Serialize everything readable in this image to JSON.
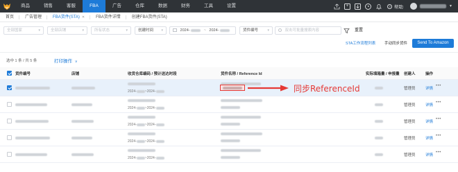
{
  "nav": {
    "items": [
      "商品",
      "销售",
      "客服",
      "FBA",
      "广告",
      "仓库",
      "数据",
      "财务",
      "工具",
      "设置"
    ],
    "active_index": 3,
    "help_label": "帮助",
    "accent_color": "#1e7bd8",
    "icons": [
      "logo-fox-icon",
      "export-icon",
      "plus-box-icon",
      "download-icon",
      "clock-icon",
      "bell-icon",
      "help-icon"
    ]
  },
  "breadcrumb_tabs": {
    "home": "首页",
    "ads": "广告管理",
    "fba_plan": "FBA货件(STA)",
    "fba_detail": "FBA货件详情",
    "create_fba": "创建FBA货件(STA)"
  },
  "filters": {
    "site": "全部国家",
    "shop": "全部店铺",
    "status": "所有状态",
    "time_type": "创建时间",
    "date_start": "2024-",
    "date_end": "2024-",
    "search_field": "货件编号",
    "search_placeholder": "双击可批量搜索内容",
    "reset_label": "重置"
  },
  "actions": {
    "sta_list": "STA工作流程列表",
    "manual_sync": "手动同步货件",
    "send_to_amazon": "Send To Amazon"
  },
  "toolbar": {
    "selection_count": "选中 1 条 / 共 5 条",
    "print_label": "打印操作",
    "print_caret": "∨"
  },
  "table": {
    "columns": [
      "货件编号",
      "店铺",
      "收货仓库编码 / 预计送达时段",
      "货件名称 / Reference Id",
      "实际填箱量 / 申报量",
      "创建人",
      "操作"
    ],
    "rows": [
      {
        "checked": true,
        "date1": "2024-",
        "date2": "2024-",
        "creator": "管理员",
        "action": "详情",
        "more": "•••"
      },
      {
        "checked": false,
        "date1": "2024-",
        "date2": "2024-",
        "creator": "管理员",
        "action": "详情",
        "more": "•••"
      },
      {
        "checked": false,
        "date1": "2024-",
        "date2": "2024-",
        "creator": "管理员",
        "action": "详情",
        "more": "•••"
      },
      {
        "checked": false,
        "date1": "2024-",
        "date2": "2024-",
        "creator": "管理员",
        "action": "详情",
        "more": "•••"
      },
      {
        "checked": false,
        "date1": "2024-",
        "date2": "2024-",
        "creator": "管理员",
        "action": "详情",
        "more": "•••"
      }
    ]
  },
  "annotation": {
    "text": "同步ReferenceId",
    "color": "#e53935"
  }
}
